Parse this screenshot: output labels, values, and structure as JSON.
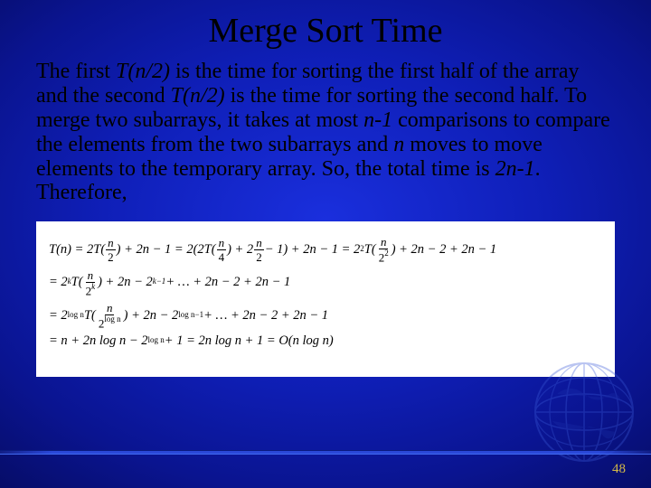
{
  "title": "Merge Sort Time",
  "body": {
    "p1a": "The first ",
    "tn2a": "T(n/2)",
    "p1b": " is the time for sorting the first half of the array and the second ",
    "tn2b": "T(n/2)",
    "p1c": " is the time for sorting the second half. To merge two subarrays, it takes at most ",
    "nm1": "n-1",
    "p1d": " comparisons to compare the elements from the two subarrays and ",
    "nmove": "n",
    "p1e": " moves to move elements to the temporary array. So, the total time is ",
    "t2n1": "2n-1",
    "p1f": ". Therefore,"
  },
  "equations": {
    "row1": {
      "lhs": "T(n) = 2T(",
      "frac1_num": "n",
      "frac1_den": "2",
      "mid1": ") + 2n − 1 = 2(2T(",
      "frac2_num": "n",
      "frac2_den": "4",
      "mid2": ") + 2",
      "frac3_num": "n",
      "frac3_den": "2",
      "mid3": " − 1) + 2n − 1 = 2",
      "sup1": "2",
      "mid4": "T(",
      "frac4_num": "n",
      "frac4_den_base": "2",
      "frac4_den_sup": "2",
      "mid5": ") + 2n − 2 + 2n − 1"
    },
    "row2": {
      "pre": "= 2",
      "supk": "k",
      "mid1": "T(",
      "frac_num": "n",
      "frac_den_base": "2",
      "frac_den_sup": "k",
      "mid2": ") + 2n − 2",
      "supk1": "k−1",
      "mid3": " + … + 2n − 2 + 2n − 1"
    },
    "row3": {
      "pre": "= 2",
      "suplog": "log n",
      "mid1": "T(",
      "frac_num": "n",
      "frac_den_base": "2",
      "frac_den_sup": "log n",
      "mid2": ") + 2n − 2",
      "suplog1": "log n−1",
      "mid3": " + … + 2n − 2 + 2n − 1"
    },
    "row4": {
      "text1": "= n + 2n log n − 2",
      "suplog": "log n",
      "text2": " + 1 = 2n log n + 1 = O(n log n)"
    }
  },
  "page_number": "48"
}
